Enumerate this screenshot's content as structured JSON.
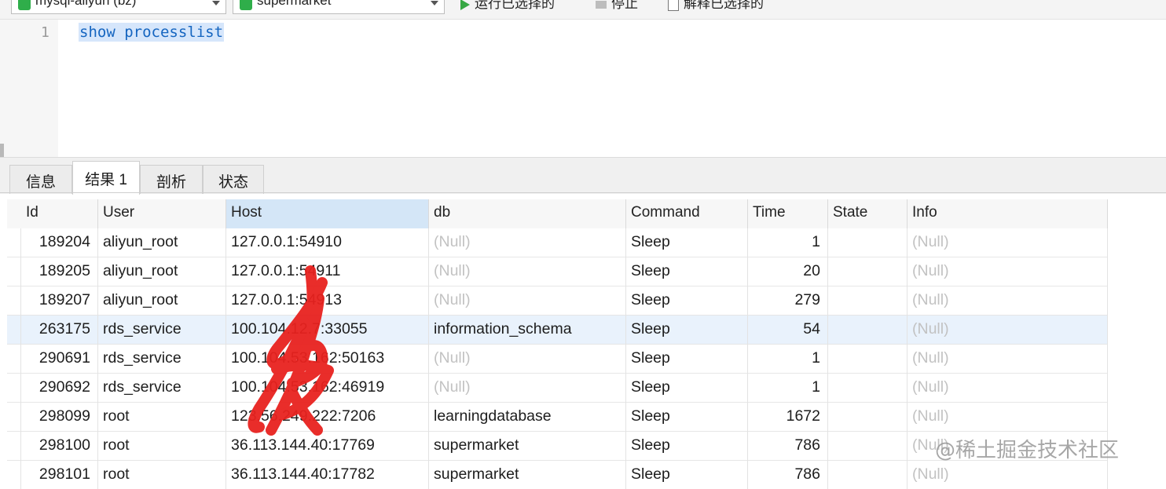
{
  "toolbar": {
    "connection_select": "mysql-aliyun (bz)",
    "database_select": "supermarket",
    "run_selected_label": "运行已选择的",
    "stop_label": "停止",
    "explain_selected_label": "解释已选择的"
  },
  "editor": {
    "line_number": "1",
    "code": "show processlist"
  },
  "result_tabs": [
    "信息",
    "结果 1",
    "剖析",
    "状态"
  ],
  "grid": {
    "columns": [
      "Id",
      "User",
      "Host",
      "db",
      "Command",
      "Time",
      "State",
      "Info"
    ],
    "rows": [
      [
        "189204",
        "aliyun_root",
        "127.0.0.1:54910",
        "(Null)",
        "Sleep",
        "1",
        "",
        "(Null)"
      ],
      [
        "189205",
        "aliyun_root",
        "127.0.0.1:54911",
        "(Null)",
        "Sleep",
        "20",
        "",
        "(Null)"
      ],
      [
        "189207",
        "aliyun_root",
        "127.0.0.1:54913",
        "(Null)",
        "Sleep",
        "279",
        "",
        "(Null)"
      ],
      [
        "263175",
        "rds_service",
        "100.104.12.7:33055",
        "information_schema",
        "Sleep",
        "54",
        "",
        "(Null)"
      ],
      [
        "290691",
        "rds_service",
        "100.104.53.162:50163",
        "(Null)",
        "Sleep",
        "1",
        "",
        "(Null)"
      ],
      [
        "290692",
        "rds_service",
        "100.104.53.162:46919",
        "(Null)",
        "Sleep",
        "1",
        "",
        "(Null)"
      ],
      [
        "298099",
        "root",
        "123.56.249.222:7206",
        "learningdatabase",
        "Sleep",
        "1672",
        "",
        "(Null)"
      ],
      [
        "298100",
        "root",
        "36.113.144.40:17769",
        "supermarket",
        "Sleep",
        "786",
        "",
        "(Null)"
      ],
      [
        "298101",
        "root",
        "36.113.144.40:17782",
        "supermarket",
        "Sleep",
        "786",
        "",
        "(Null)"
      ]
    ]
  },
  "watermark": "@稀土掘金技术社区",
  "colors": {
    "selection_bg": "#d6e6fb",
    "keyword_blue": "#1565c0",
    "null_gray": "#c2c2c2",
    "row_highlight": "#e9f2fc",
    "scribble_red": "#e8221f"
  }
}
